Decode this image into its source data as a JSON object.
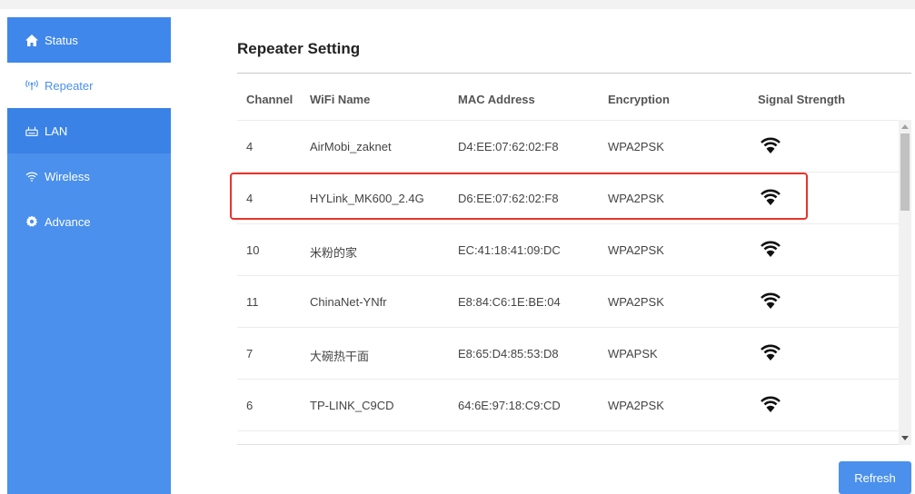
{
  "sidebar": {
    "items": [
      {
        "label": "Status",
        "icon": "home-icon"
      },
      {
        "label": "Repeater",
        "icon": "repeater-icon"
      },
      {
        "label": "LAN",
        "icon": "router-icon"
      },
      {
        "label": "Wireless",
        "icon": "wifi-icon"
      },
      {
        "label": "Advance",
        "icon": "gear-icon"
      }
    ],
    "active_index": 1
  },
  "main": {
    "title": "Repeater Setting",
    "columns": [
      "Channel",
      "WiFi Name",
      "MAC Address",
      "Encryption",
      "Signal Strength"
    ],
    "rows": [
      {
        "channel": "4",
        "name": "AirMobi_zaknet",
        "mac": "D4:EE:07:62:02:F8",
        "encryption": "WPA2PSK"
      },
      {
        "channel": "4",
        "name": "HYLink_MK600_2.4G",
        "mac": "D6:EE:07:62:02:F8",
        "encryption": "WPA2PSK"
      },
      {
        "channel": "10",
        "name": "米粉的家",
        "mac": "EC:41:18:41:09:DC",
        "encryption": "WPA2PSK"
      },
      {
        "channel": "11",
        "name": "ChinaNet-YNfr",
        "mac": "E8:84:C6:1E:BE:04",
        "encryption": "WPA2PSK"
      },
      {
        "channel": "7",
        "name": "大碗热干面",
        "mac": "E8:65:D4:85:53:D8",
        "encryption": "WPAPSK"
      },
      {
        "channel": "6",
        "name": "TP-LINK_C9CD",
        "mac": "64:6E:97:18:C9:CD",
        "encryption": "WPA2PSK"
      }
    ],
    "highlighted_row": 1,
    "refresh_label": "Refresh"
  },
  "colors": {
    "sidebar": "#4a90ec",
    "accent": "#4a90ec",
    "highlight": "#e8332b"
  }
}
